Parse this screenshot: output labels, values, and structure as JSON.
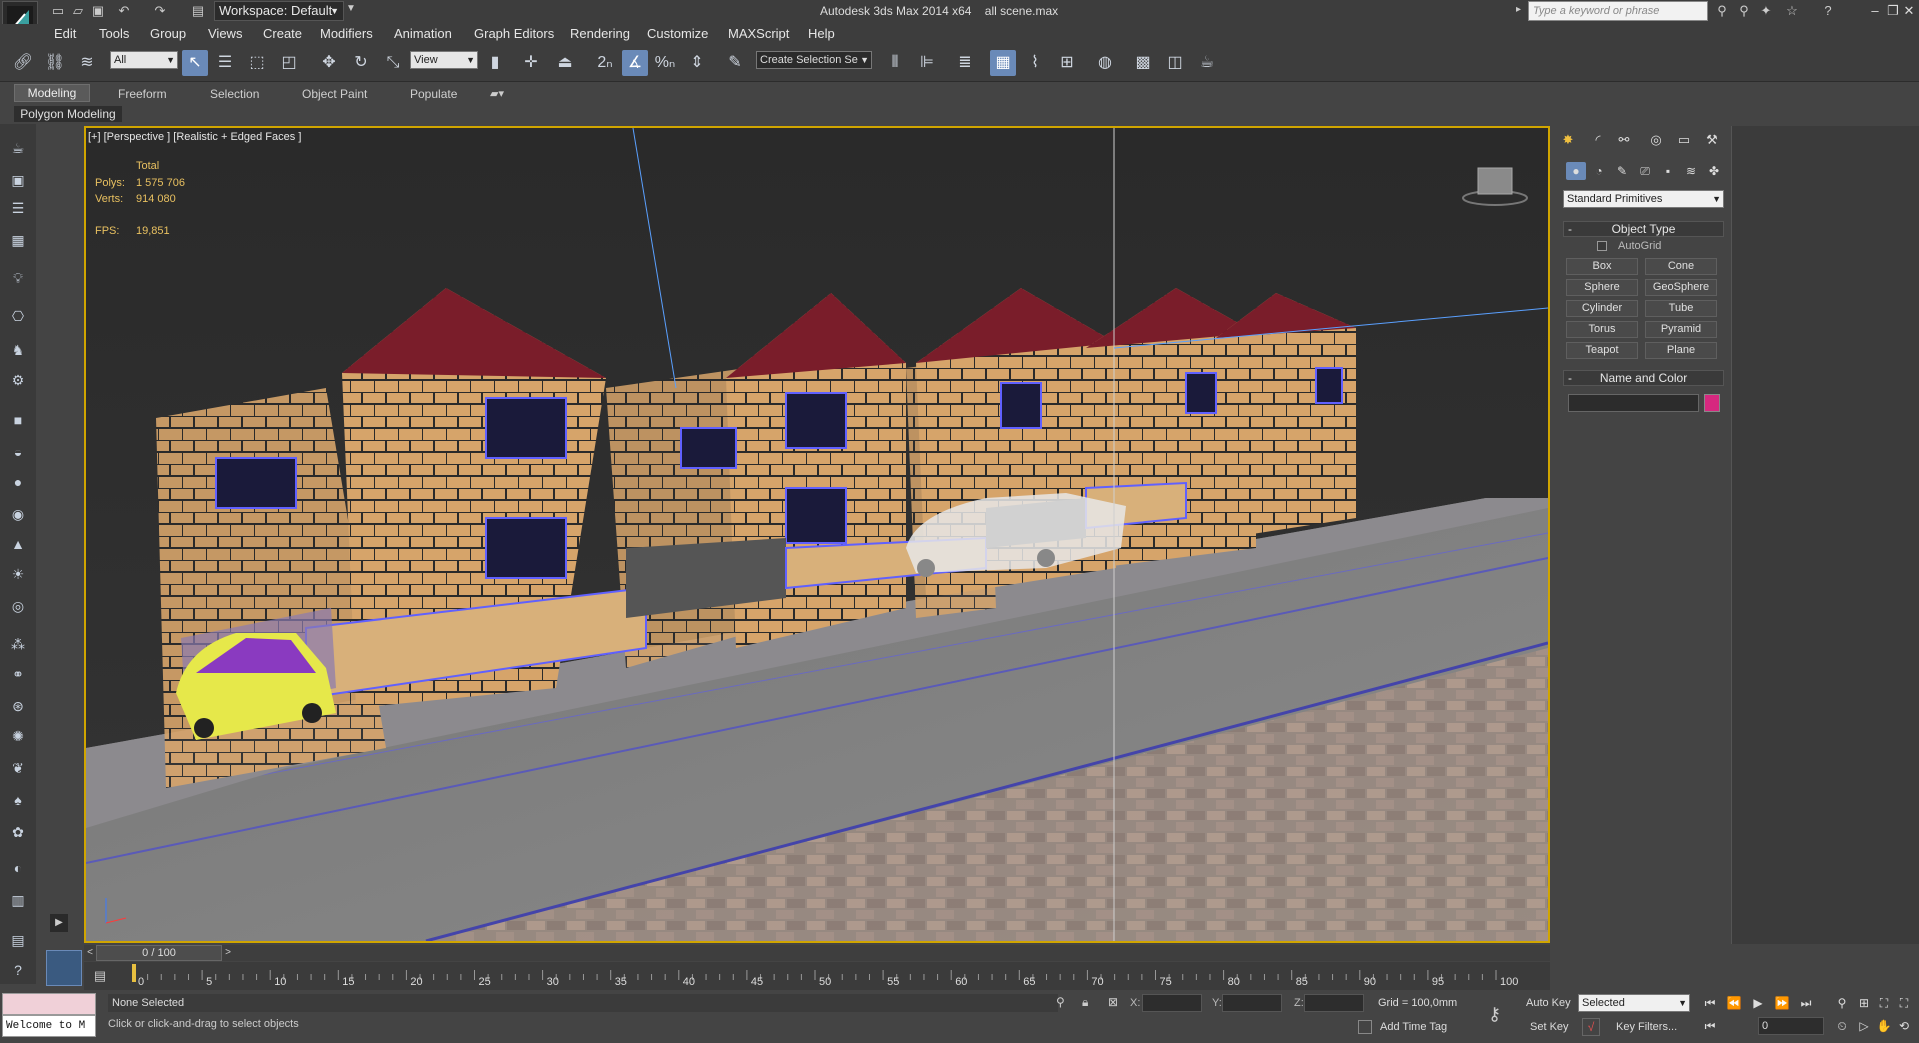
{
  "titlebar": {
    "workspace": "Workspace: Default",
    "app_title": "Autodesk 3ds Max  2014 x64",
    "file_name": "all scene.max",
    "search_placeholder": "Type a keyword or phrase"
  },
  "menu": [
    "Edit",
    "Tools",
    "Group",
    "Views",
    "Create",
    "Modifiers",
    "Animation",
    "Graph Editors",
    "Rendering",
    "Customize",
    "MAXScript",
    "Help"
  ],
  "toolbar": {
    "selection_filter": "All",
    "ref_coord": "View",
    "named_selection": "Create Selection Se"
  },
  "ribbon": {
    "tabs": [
      "Modeling",
      "Freeform",
      "Selection",
      "Object Paint",
      "Populate"
    ],
    "panel_label": "Polygon Modeling"
  },
  "viewport": {
    "label": "[+] [Perspective ] [Realistic + Edged Faces ]",
    "stats_header": "Total",
    "polys_label": "Polys:",
    "polys_value": "1 575 706",
    "verts_label": "Verts:",
    "verts_value": "914 080",
    "fps_label": "FPS:",
    "fps_value": "19,851"
  },
  "command_panel": {
    "category": "Standard Primitives",
    "object_type_title": "Object Type",
    "autogrid_label": "AutoGrid",
    "primitives": [
      "Box",
      "Cone",
      "Sphere",
      "GeoSphere",
      "Cylinder",
      "Tube",
      "Torus",
      "Pyramid",
      "Teapot",
      "Plane"
    ],
    "name_color_title": "Name and Color",
    "color": "#d6287f"
  },
  "timeline": {
    "slider_label": "0 / 100",
    "ticks": [
      "0",
      "5",
      "10",
      "15",
      "20",
      "25",
      "30",
      "35",
      "40",
      "45",
      "50",
      "55",
      "60",
      "65",
      "70",
      "75",
      "80",
      "85",
      "90",
      "95",
      "100"
    ]
  },
  "status": {
    "maxscript_text": "Welcome to M",
    "selection_info": "None Selected",
    "prompt": "Click or click-and-drag to select objects",
    "x_label": "X:",
    "y_label": "Y:",
    "z_label": "Z:",
    "grid": "Grid = 100,0mm",
    "add_time_tag": "Add Time Tag",
    "auto_key": "Auto Key",
    "set_key": "Set Key",
    "key_mode": "Selected",
    "key_filters": "Key Filters...",
    "frame": "0"
  }
}
